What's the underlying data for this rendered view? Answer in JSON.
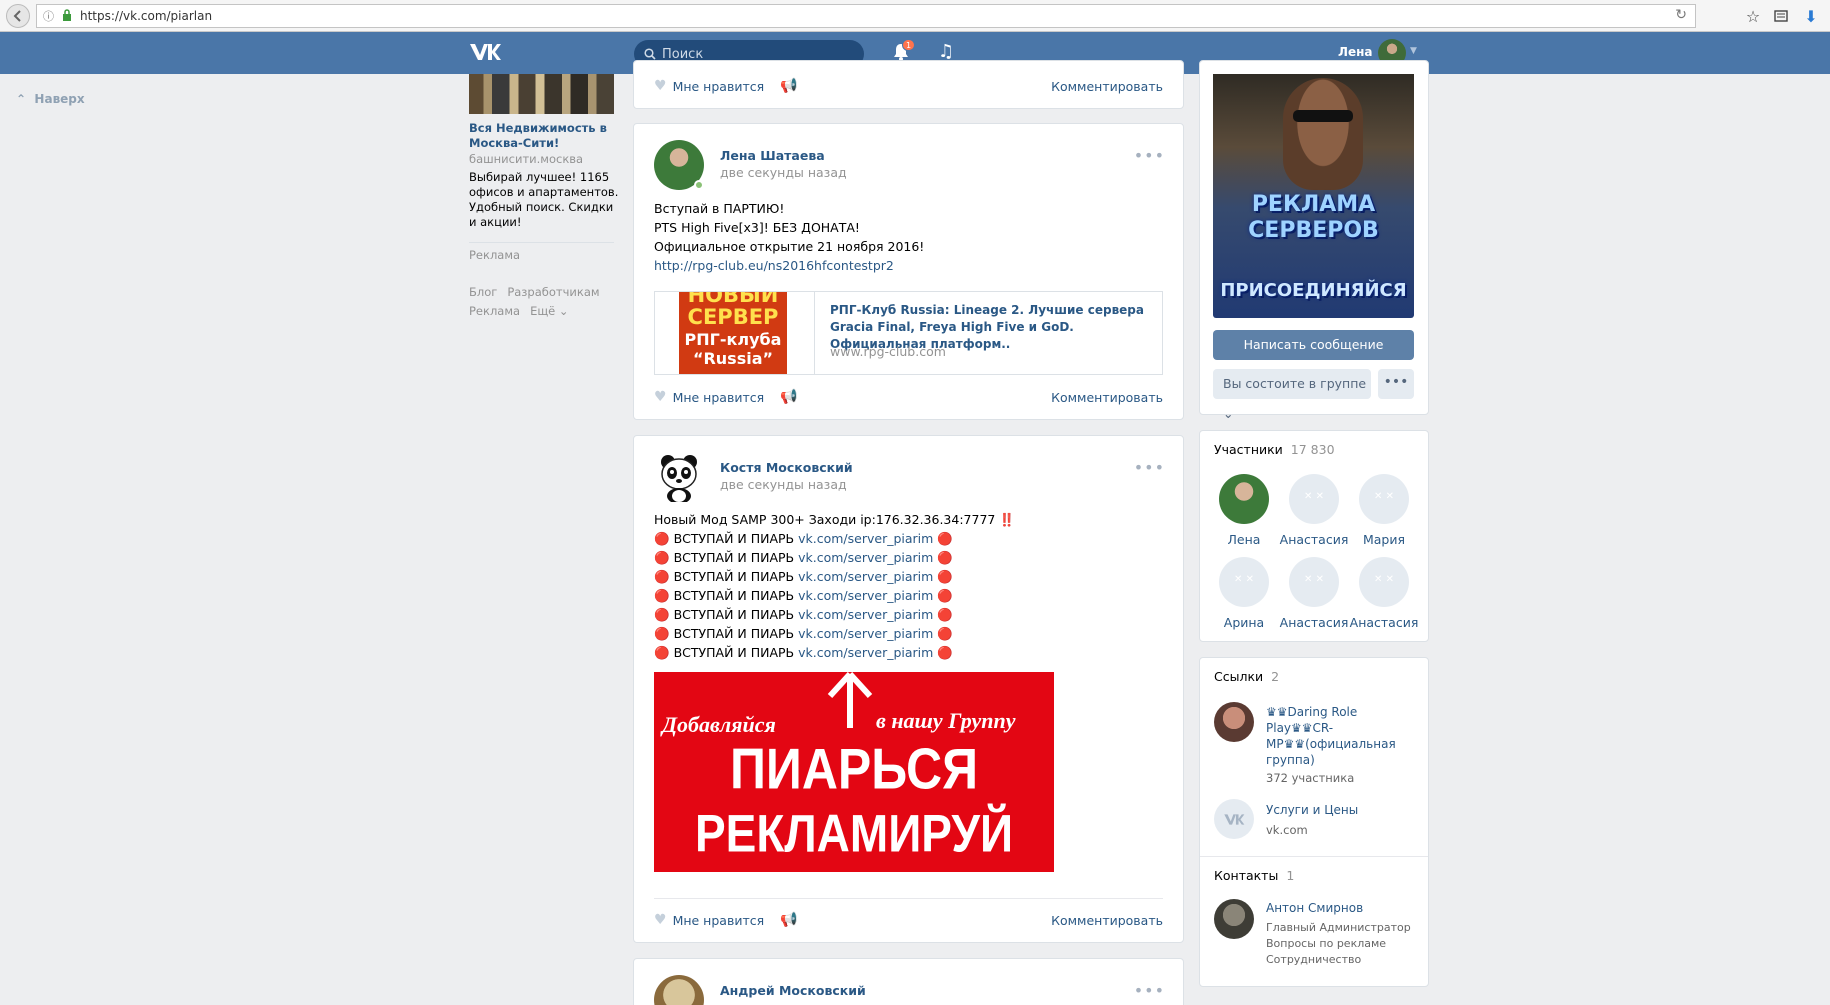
{
  "browser": {
    "url": "https://vk.com/piarlan"
  },
  "header": {
    "search_placeholder": "Поиск",
    "notifications_count": "1",
    "user_name": "Лена"
  },
  "left": {
    "to_top": "Наверх",
    "ad": {
      "title": "Вся Недвижимость в Москва-Сити!",
      "domain": "башнисити.москва",
      "description": "Выбирай лучшее! 1165 офисов и апартаментов. Удобный поиск. Скидки и акции!",
      "label": "Реклама"
    },
    "footer": [
      "Блог",
      "Разработчикам",
      "Реклама",
      "Ещё ⌄"
    ]
  },
  "feed": {
    "like_label": "Мне нравится",
    "comment_label": "Комментировать",
    "posts": [
      {
        "author": "Лена Шатаева",
        "time": "две секунды назад",
        "lines": [
          "Вступай в ПАРТИЮ!",
          "PTS High Five[x3]! БЕЗ ДОНАТА!",
          "Официальное открытие 21 ноября 2016!"
        ],
        "link": "http://rpg-club.eu/ns2016hfcontestpr2",
        "attachment": {
          "image_lines": [
            "НОВЫЙ",
            "СЕРВЕР",
            "РПГ-клуба",
            "“Russia”"
          ],
          "title": "РПГ-Клуб Russia: Lineage 2. Лучшие сервера Gracia Final, Freya High Five и GoD. Официальная платформ..",
          "domain": "www.rpg-club.com"
        }
      },
      {
        "author": "Костя Московский",
        "time": "две секунды назад",
        "first_line": "Новый Мод SAMP 300+ Заходи ip:176.32.36.34:7777 ‼️",
        "repeat_text": "ВСТУПАЙ И ПИАРЬ",
        "repeat_link": "vk.com/server_piarim",
        "banner": {
          "left": "Добавляйся",
          "right": "в нашу Группу",
          "line1": "ПИАРЬСЯ",
          "line2": "РЕКЛАМИРУЙ"
        }
      },
      {
        "author": "Андрей Московский"
      }
    ]
  },
  "right": {
    "banner": {
      "title": "РЕКЛАМА СЕРВЕРОВ",
      "subtitle": "ПРИСОЕДИНЯЙСЯ"
    },
    "message_button": "Написать сообщение",
    "member_button": "Вы состоите в группе ⌄",
    "more_button": "•••",
    "members": {
      "title": "Участники",
      "count": "17 830",
      "items": [
        "Лена",
        "Анастасия",
        "Мария",
        "Арина",
        "Анастасия",
        "Анастасия"
      ]
    },
    "links": {
      "title": "Ссылки",
      "count": "2",
      "items": [
        {
          "name": "♛♛Daring Role Play♛♛CR-MP♛♛(официальная группа)",
          "sub": "372 участника"
        },
        {
          "name": "Услуги и Цены",
          "sub": "vk.com"
        }
      ]
    },
    "contacts": {
      "title": "Контакты",
      "count": "1",
      "items": [
        {
          "name": "Антон Смирнов",
          "role": "Главный Администратор Вопросы по рекламе Сотрудничество"
        }
      ]
    }
  },
  "colors": {
    "header": "#4a76a8",
    "link": "#2a5885",
    "banner_red": "#e30613"
  }
}
